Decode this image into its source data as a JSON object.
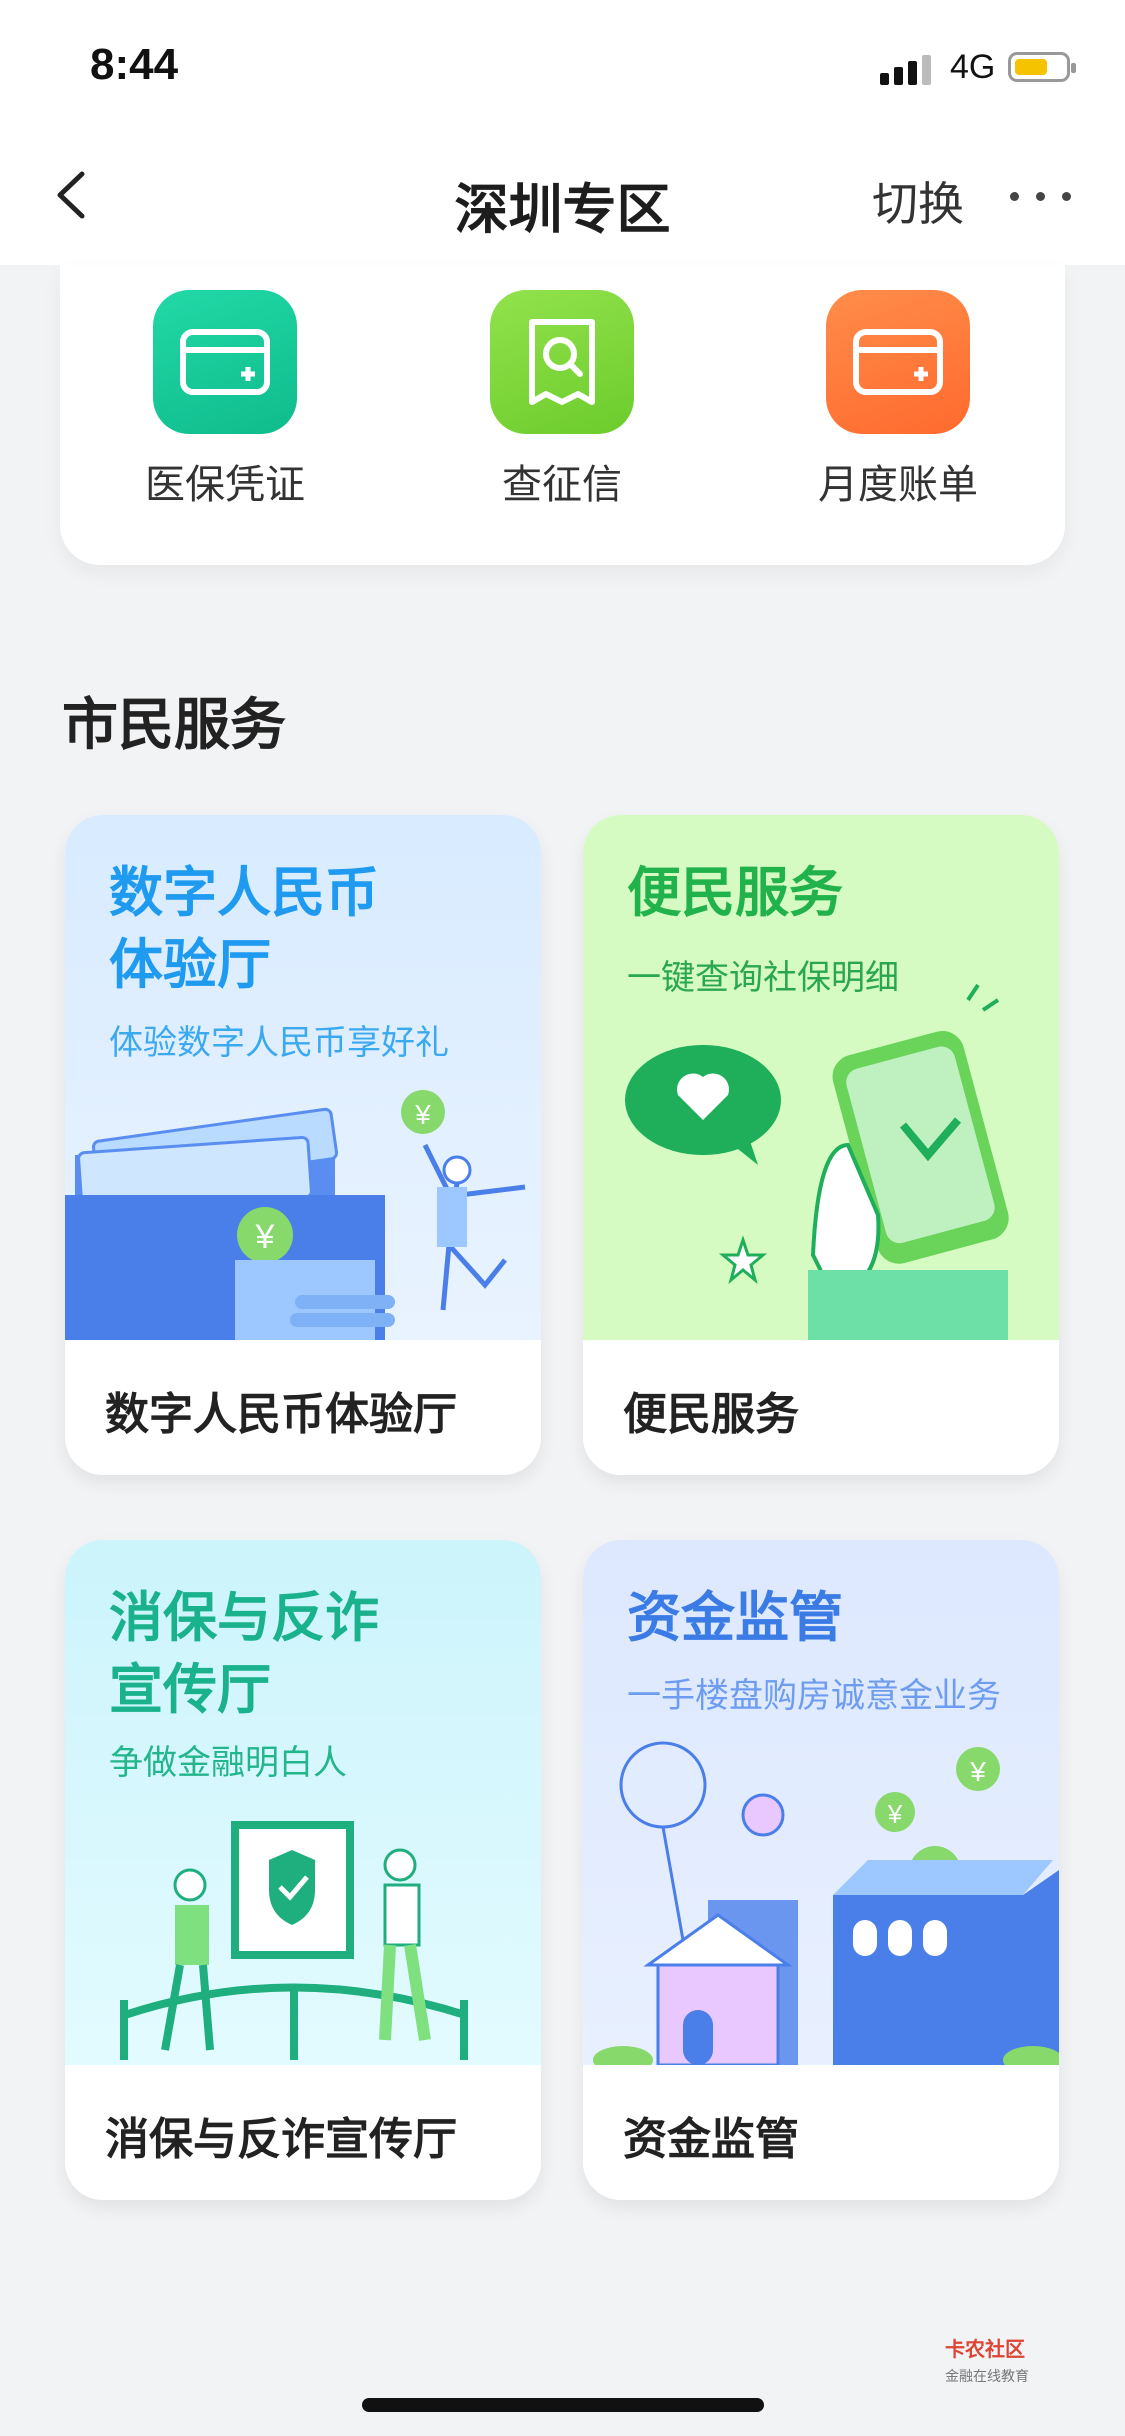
{
  "status_bar": {
    "time": "8:44",
    "network": "4G"
  },
  "nav": {
    "title": "深圳专区",
    "switch_label": "切换"
  },
  "quick_actions": [
    {
      "label": "医保凭证",
      "icon": "card-icon",
      "color": "#14c99a"
    },
    {
      "label": "查征信",
      "icon": "search-document-icon",
      "color": "#7fd83c"
    },
    {
      "label": "月度账单",
      "icon": "bill-icon",
      "color": "#ff7a3c"
    }
  ],
  "section": {
    "title": "市民服务"
  },
  "cards": [
    {
      "title_line1": "数字人民币",
      "title_line2": "体验厅",
      "subtitle": "体验数字人民币享好礼",
      "label": "数字人民币体验厅",
      "bg": "#e3f0ff",
      "title_color": "#1e9af0"
    },
    {
      "title_line1": "便民服务",
      "title_line2": "",
      "subtitle": "一键查询社保明细",
      "label": "便民服务",
      "bg": "#d9fac4",
      "title_color": "#21b24b"
    },
    {
      "title_line1": "消保与反诈",
      "title_line2": "宣传厅",
      "subtitle": "争做金融明白人",
      "label": "消保与反诈宣传厅",
      "bg": "#d6f6fb",
      "title_color": "#19b28c"
    },
    {
      "title_line1": "资金监管",
      "title_line2": "",
      "subtitle": "一手楼盘购房诚意金业务",
      "label": "资金监管",
      "bg": "#e2ecff",
      "title_color": "#3a7be6"
    }
  ],
  "illustration_symbols": {
    "yuan": "¥"
  },
  "watermark": {
    "line1": "卡农社区",
    "line2": "金融在线教育"
  }
}
